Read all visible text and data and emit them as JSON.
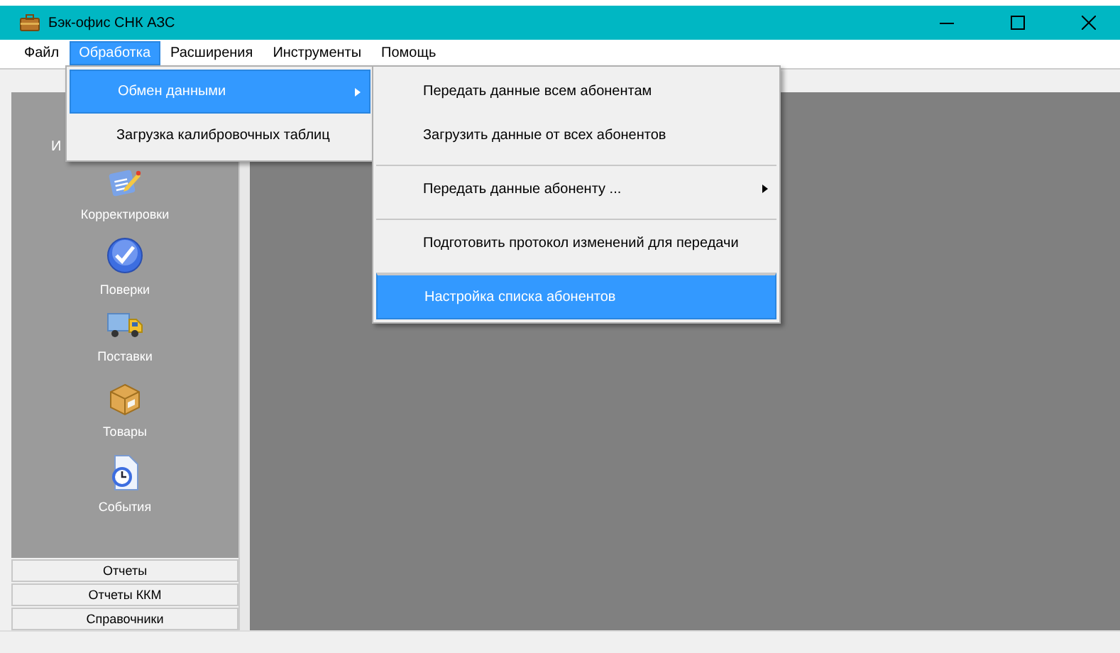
{
  "window": {
    "title": "Бэк-офис СНК АЗС"
  },
  "menu": [
    {
      "label": "Файл",
      "selected": false
    },
    {
      "label": "Обработка",
      "selected": true
    },
    {
      "label": "Расширения",
      "selected": false
    },
    {
      "label": "Инструменты",
      "selected": false
    },
    {
      "label": "Помощь",
      "selected": false
    }
  ],
  "dropdown": [
    {
      "label": "Обмен данными",
      "selected": true,
      "submenu": true
    },
    {
      "label": "Загрузка калибровочных таблиц",
      "selected": false,
      "submenu": false
    }
  ],
  "submenu": [
    {
      "label": "Передать данные всем абонентам",
      "selected": false,
      "submenu": false,
      "separator_before": false
    },
    {
      "label": "Загрузить данные от всех абонентов",
      "selected": false,
      "submenu": false,
      "separator_before": false
    },
    {
      "label": "Передать данные абоненту ...",
      "selected": false,
      "submenu": true,
      "separator_before": true
    },
    {
      "label": "Подготовить протокол изменений для передачи",
      "selected": false,
      "submenu": false,
      "separator_before": true
    },
    {
      "label": "Настройка списка абонентов",
      "selected": true,
      "submenu": false,
      "separator_before": true
    }
  ],
  "sidebar": {
    "header": "И",
    "items": [
      {
        "label": "Корректировки",
        "kind": "edit"
      },
      {
        "label": "Поверки",
        "kind": "check"
      },
      {
        "label": "Поставки",
        "kind": "truck"
      },
      {
        "label": "Товары",
        "kind": "box"
      },
      {
        "label": "События",
        "kind": "clock"
      }
    ],
    "sections": [
      "Отчеты",
      "Отчеты ККМ",
      "Справочники"
    ]
  }
}
